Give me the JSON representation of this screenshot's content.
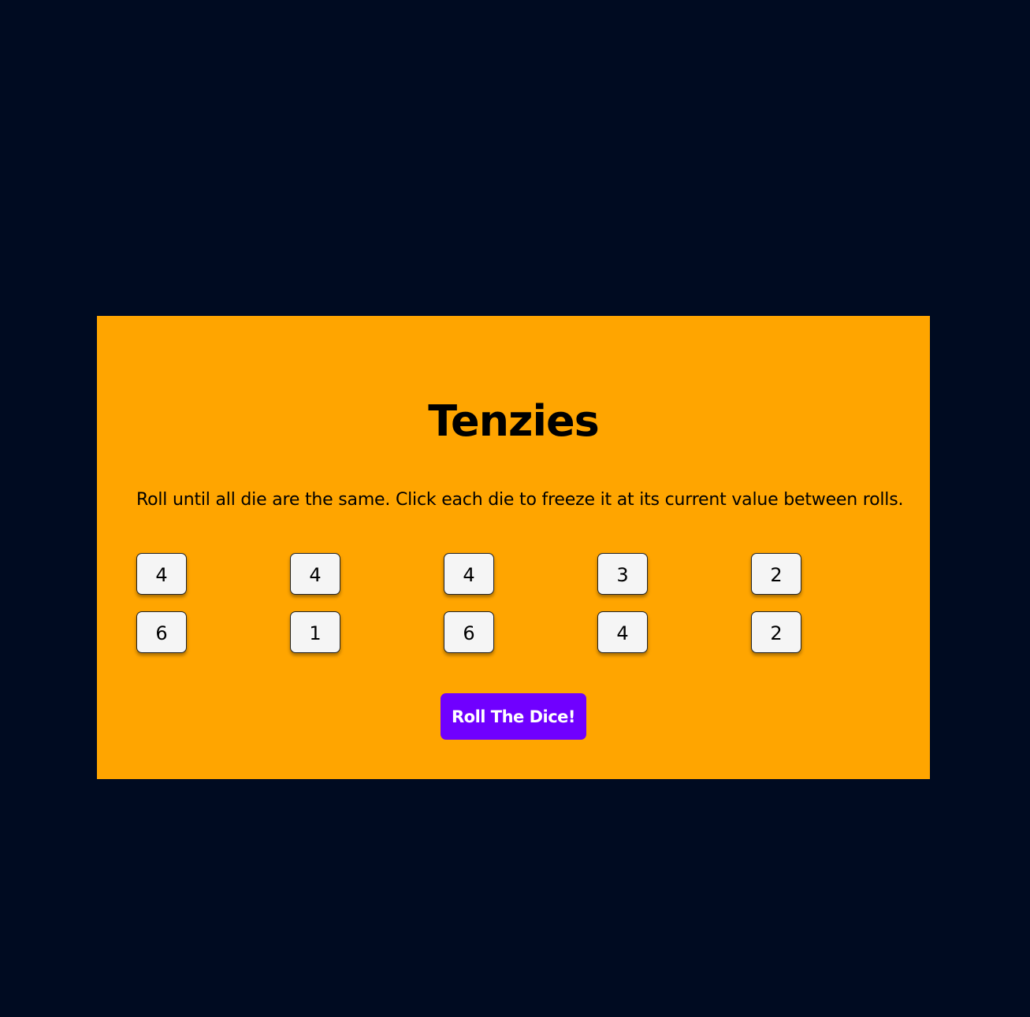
{
  "game": {
    "title": "Tenzies",
    "instructions": "Roll until all die are the same. Click each die to freeze it at its current value between rolls.",
    "dice": [
      "4",
      "4",
      "4",
      "3",
      "2",
      "6",
      "1",
      "6",
      "4",
      "2"
    ],
    "roll_button_label": "Roll The Dice!"
  },
  "colors": {
    "page_background": "#000b21",
    "board_background": "#ffa500",
    "die_face": "#f5f5f5",
    "button_background": "#7000ff",
    "button_text": "#ffffff"
  }
}
